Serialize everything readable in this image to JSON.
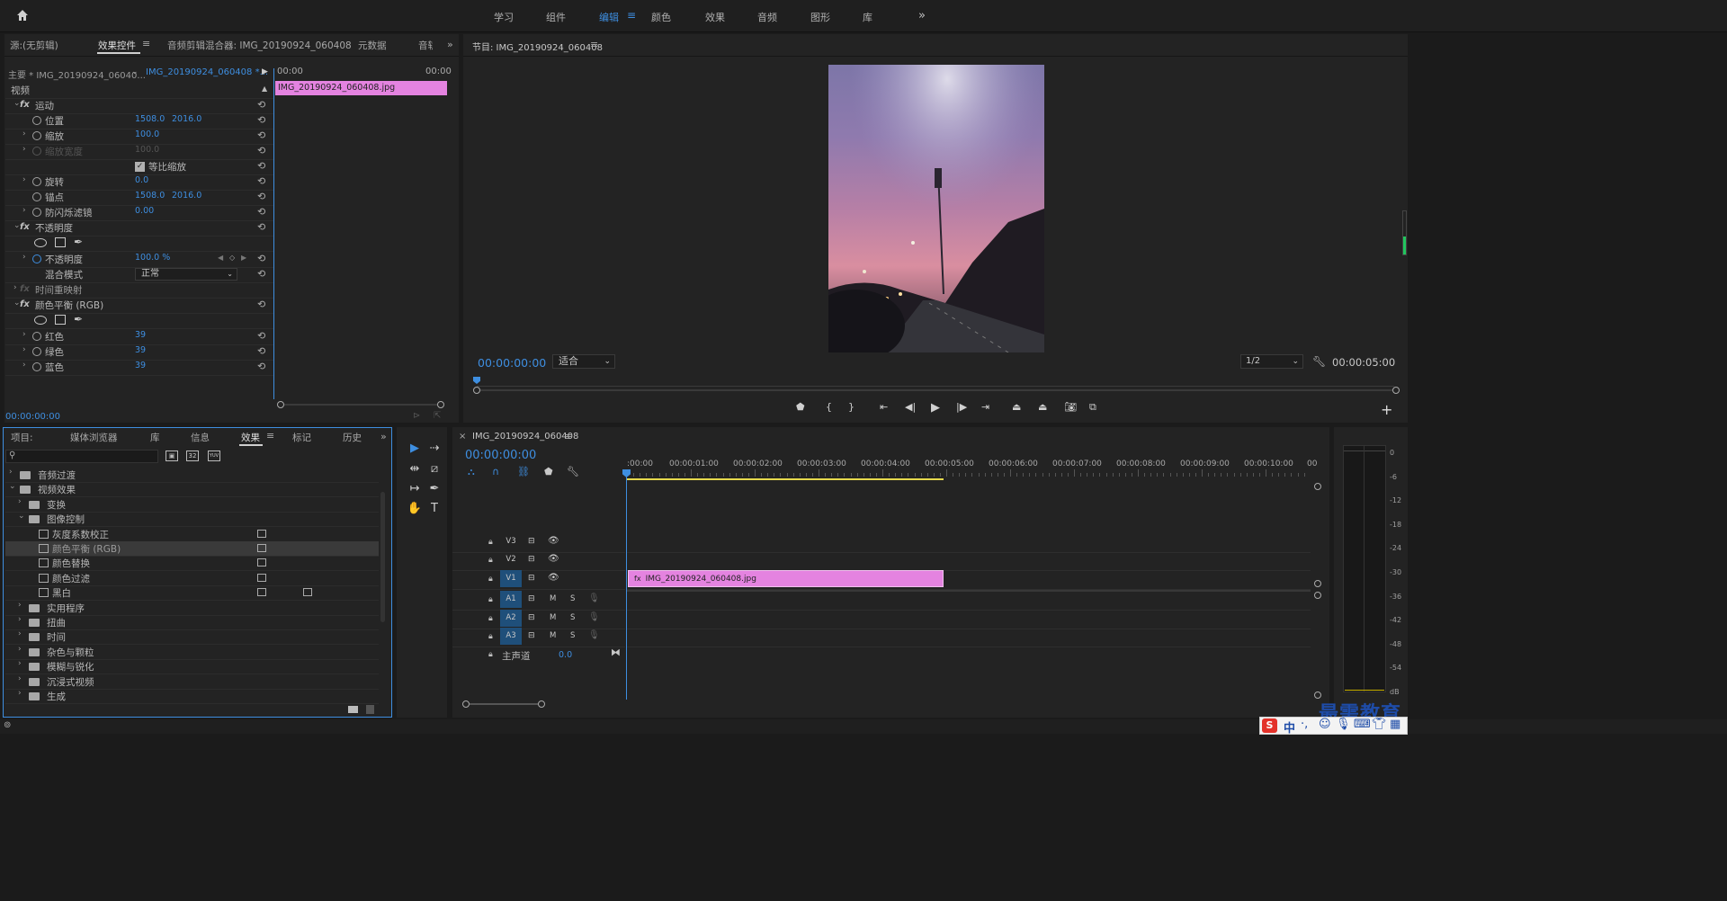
{
  "nav": {
    "home": "home-icon",
    "tabs": [
      "学习",
      "组件",
      "编辑",
      "颜色",
      "效果",
      "音频",
      "图形",
      "库"
    ],
    "active": "编辑",
    "more": "»"
  },
  "src": {
    "tabs": [
      "源:(无剪辑)",
      "效果控件",
      "音频剪辑混合器: IMG_20190924_060408",
      "元数据",
      "音轨"
    ],
    "master": "主要 * IMG_20190924_06040...",
    "clip": "IMG_20190924_060408 *...",
    "tc_l": "00:00",
    "tc_r": "00:00",
    "clip_bar": "IMG_20190924_060408.jpg",
    "video": "视频",
    "motion": "运动",
    "pos": "位置",
    "pos_x": "1508.0",
    "pos_y": "2016.0",
    "scale": "缩放",
    "scale_v": "100.0",
    "scalew": "缩放宽度",
    "scalew_v": "100.0",
    "uniform": "等比缩放",
    "rot": "旋转",
    "rot_v": "0.0",
    "anchor": "锚点",
    "anc_x": "1508.0",
    "anc_y": "2016.0",
    "flicker": "防闪烁滤镜",
    "flicker_v": "0.00",
    "opacity": "不透明度",
    "opa": "不透明度",
    "opa_v": "100.0 %",
    "blend": "混合模式",
    "blend_v": "正常",
    "remap": "时间重映射",
    "cb": "颜色平衡 (RGB)",
    "red": "红色",
    "red_v": "39",
    "green": "绿色",
    "green_v": "39",
    "blue": "蓝色",
    "blue_v": "39",
    "tc": "00:00:00:00"
  },
  "prog": {
    "title": "节目: IMG_20190924_060408",
    "tc": "00:00:00:00",
    "fit": "适合",
    "res": "1/2",
    "dur": "00:00:05:00"
  },
  "proj": {
    "tabs": [
      "项目:",
      "媒体浏览器",
      "库",
      "信息",
      "效果",
      "标记",
      "历史"
    ],
    "active": "效果",
    "items": [
      {
        "t": "音频过渡",
        "lv": 0,
        "k": "folder",
        "o": false
      },
      {
        "t": "视频效果",
        "lv": 0,
        "k": "folder",
        "o": true
      },
      {
        "t": "变换",
        "lv": 1,
        "k": "folder",
        "o": false
      },
      {
        "t": "图像控制",
        "lv": 1,
        "k": "folder",
        "o": true
      },
      {
        "t": "灰度系数校正",
        "lv": 2,
        "k": "fx"
      },
      {
        "t": "颜色平衡 (RGB)",
        "lv": 2,
        "k": "fx",
        "sel": true
      },
      {
        "t": "颜色替换",
        "lv": 2,
        "k": "fx"
      },
      {
        "t": "颜色过滤",
        "lv": 2,
        "k": "fx"
      },
      {
        "t": "黑白",
        "lv": 2,
        "k": "fx"
      },
      {
        "t": "实用程序",
        "lv": 1,
        "k": "folder",
        "o": false
      },
      {
        "t": "扭曲",
        "lv": 1,
        "k": "folder",
        "o": false
      },
      {
        "t": "时间",
        "lv": 1,
        "k": "folder",
        "o": false
      },
      {
        "t": "杂色与颗粒",
        "lv": 1,
        "k": "folder",
        "o": false
      },
      {
        "t": "模糊与锐化",
        "lv": 1,
        "k": "folder",
        "o": false
      },
      {
        "t": "沉浸式视频",
        "lv": 1,
        "k": "folder",
        "o": false
      },
      {
        "t": "生成",
        "lv": 1,
        "k": "folder",
        "o": false
      }
    ],
    "badges": [
      "32",
      "YUV"
    ]
  },
  "tl": {
    "title": "IMG_20190924_060408",
    "tc": "00:00:00:00",
    "ticks": [
      ":00:00",
      "00:00:01:00",
      "00:00:02:00",
      "00:00:03:00",
      "00:00:04:00",
      "00:00:05:00",
      "00:00:06:00",
      "00:00:07:00",
      "00:00:08:00",
      "00:00:09:00",
      "00:00:10:00",
      "00"
    ],
    "tracks": [
      "V3",
      "V2",
      "V1",
      "A1",
      "A2",
      "A3"
    ],
    "m": "M",
    "s": "S",
    "master": "主声道",
    "master_v": "0.0",
    "clip": "IMG_20190924_060408.jpg"
  },
  "meter": {
    "labels": [
      "0",
      "-6",
      "-12",
      "-18",
      "-24",
      "-30",
      "-36",
      "-42",
      "-48",
      "-54",
      "dB"
    ]
  },
  "wm": {
    "title": "最需教育",
    "ime": "中"
  }
}
